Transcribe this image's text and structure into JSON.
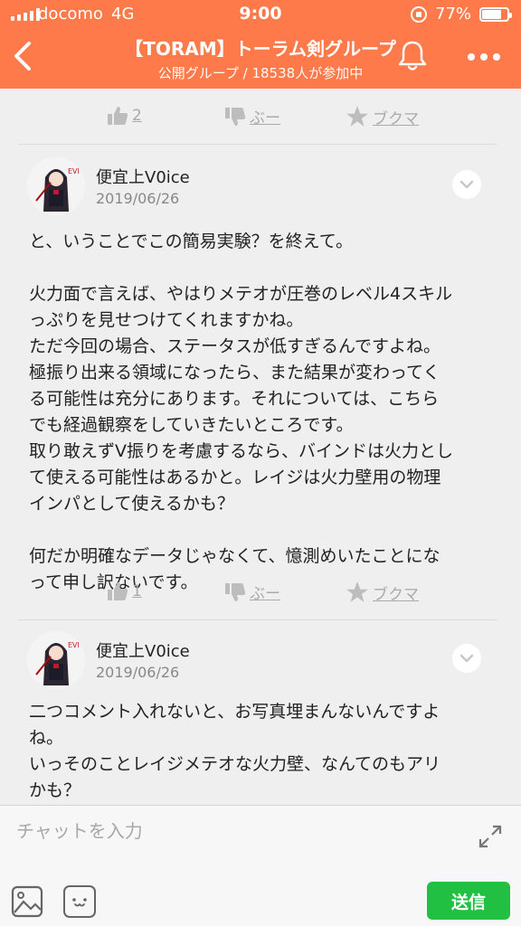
{
  "status_bar": {
    "carrier": "docomo",
    "network": "4G",
    "time": "9:00",
    "battery_percent": "77%",
    "battery_level": 0.77
  },
  "header": {
    "title": "【TORAM】トーラム剣グループ",
    "subtitle": "公開グループ / 18538人が参加中",
    "accent_color": "#ff7a4a"
  },
  "reaction_bars": [
    {
      "likes": "2",
      "dislike_label": "ぶー",
      "bookmark_label": "ブクマ"
    },
    {
      "likes": "1",
      "dislike_label": "ぶー",
      "bookmark_label": "ブクマ"
    }
  ],
  "comments": [
    {
      "author": "便宜上V0ice",
      "date": "2019/06/26",
      "lines": [
        "と、いうことでこの簡易実験？を終えて。",
        "",
        "火力面で言えば、やはりメテオが圧巻のレベル4スキル",
        "っぷりを見せつけてくれますかね。",
        "ただ今回の場合、ステータスが低すぎるんですよね。",
        "極振り出来る領域になったら、また結果が変わってく",
        "る可能性は充分にあります。それについては、こちら",
        "でも経過観察をしていきたいところです。",
        "取り敢えずV振りを考慮するなら、バインドは火力とし",
        "て使える可能性はあるかと。レイジは火力壁用の物理",
        "インパとして使えるかも？",
        "",
        "何だか明確なデータじゃなくて、憶測めいたことにな",
        "って申し訳ないです。"
      ]
    },
    {
      "author": "便宜上V0ice",
      "date": "2019/06/26",
      "lines": [
        "二つコメント入れないと、お写真埋まんないんですよ",
        "ね。",
        "いっそのことレイジメテオな火力壁、なんてのもアリ",
        "かも？"
      ]
    }
  ],
  "composer": {
    "placeholder": "チャットを入力",
    "send_label": "送信",
    "send_color": "#22c042"
  },
  "icons": [
    "back-icon",
    "bell-icon",
    "more-icon",
    "thumbs-up-icon",
    "thumbs-down-icon",
    "star-icon",
    "chevron-down-icon",
    "expand-icon",
    "image-icon",
    "emoji-icon"
  ]
}
